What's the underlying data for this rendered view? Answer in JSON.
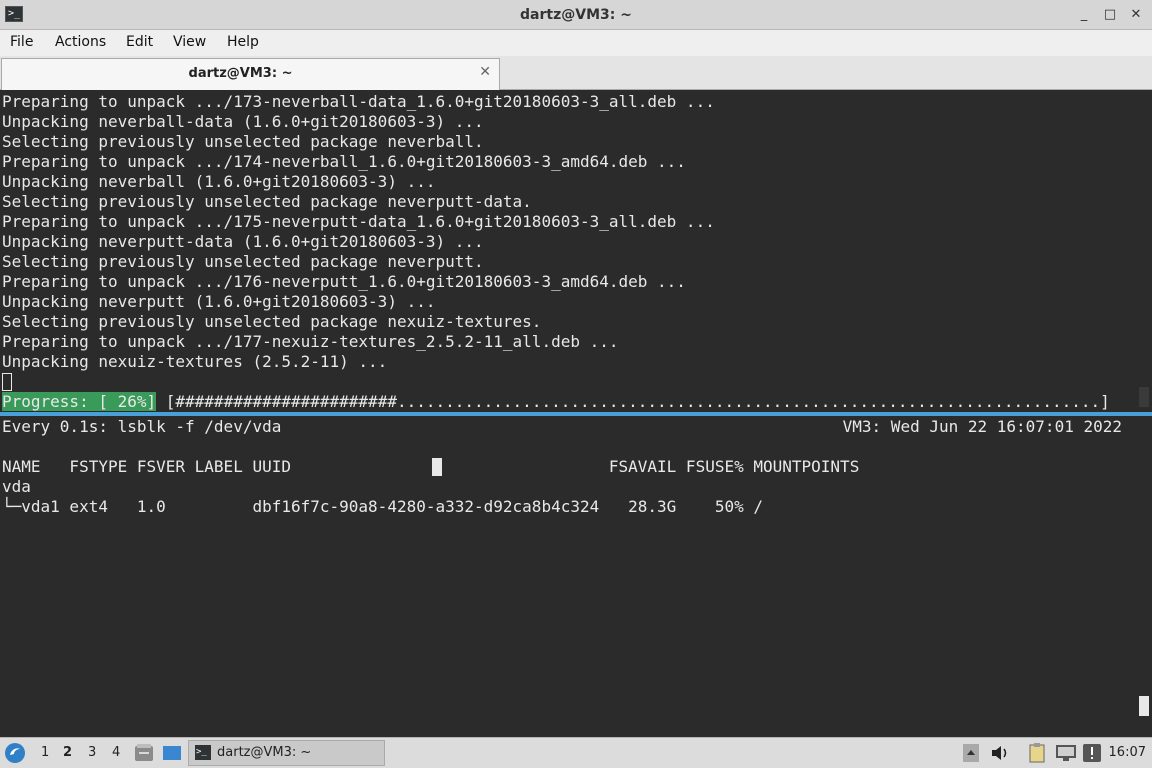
{
  "window": {
    "title": "dartz@VM3: ~",
    "minimize": "_",
    "maximize": "□",
    "close": "✕"
  },
  "menu": [
    "File",
    "Actions",
    "Edit",
    "View",
    "Help"
  ],
  "tab": {
    "label": "dartz@VM3: ~",
    "close": "✕"
  },
  "top_pane": {
    "lines": [
      "Preparing to unpack .../173-neverball-data_1.6.0+git20180603-3_all.deb ...",
      "Unpacking neverball-data (1.6.0+git20180603-3) ...",
      "Selecting previously unselected package neverball.",
      "Preparing to unpack .../174-neverball_1.6.0+git20180603-3_amd64.deb ...",
      "Unpacking neverball (1.6.0+git20180603-3) ...",
      "Selecting previously unselected package neverputt-data.",
      "Preparing to unpack .../175-neverputt-data_1.6.0+git20180603-3_all.deb ...",
      "Unpacking neverputt-data (1.6.0+git20180603-3) ...",
      "Selecting previously unselected package neverputt.",
      "Preparing to unpack .../176-neverputt_1.6.0+git20180603-3_amd64.deb ...",
      "Unpacking neverputt (1.6.0+git20180603-3) ...",
      "Selecting previously unselected package nexuiz-textures.",
      "Preparing to unpack .../177-nexuiz-textures_2.5.2-11_all.deb ...",
      "Unpacking nexuiz-textures (2.5.2-11) ..."
    ],
    "progress_label": "Progress: [ 26%]",
    "progress_bar": "[#######################.........................................................................]",
    "progress_value": 0.26
  },
  "bottom_pane": {
    "watch_header": "Every 0.1s: lsblk -f /dev/vda",
    "host_time": "VM3: Wed Jun 22 16:07:01 2022",
    "columns_header": "NAME   FSTYPE FSVER LABEL UUID                                 FSAVAIL FSUSE% MOUNTPOINTS",
    "rows": [
      "vda",
      "└─vda1 ext4   1.0         dbf16f7c-90a8-4280-a332-d92ca8b4c324   28.3G    50% /"
    ]
  },
  "taskbar": {
    "workspaces": [
      "1",
      "2",
      "3",
      "4"
    ],
    "active_workspace": "2",
    "task_label": "dartz@VM3: ~",
    "clock": "16:07"
  },
  "colors": {
    "terminal_bg": "#2b2b2b",
    "terminal_fg": "#e8e8e8",
    "progress_green": "#3a9a5a",
    "split_accent": "#4a9fd8"
  }
}
